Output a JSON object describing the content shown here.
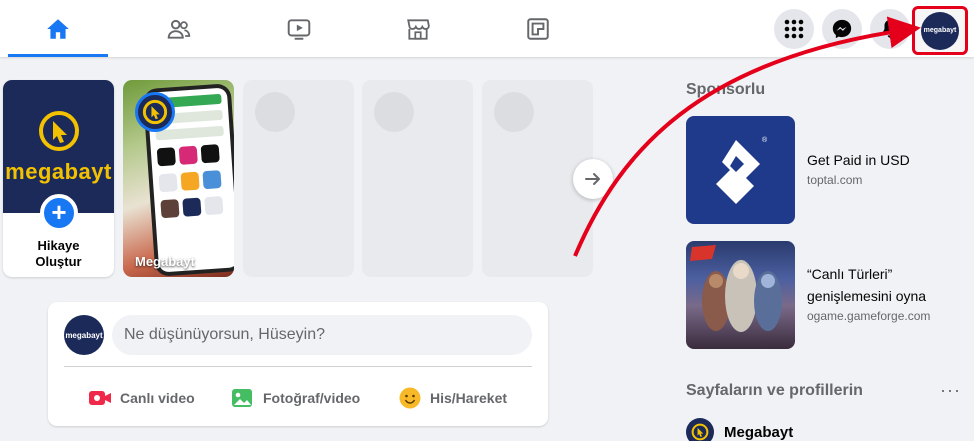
{
  "nav": {
    "tabs": [
      {
        "name": "home-icon",
        "active": true
      },
      {
        "name": "friends-icon",
        "active": false
      },
      {
        "name": "watch-icon",
        "active": false
      },
      {
        "name": "marketplace-icon",
        "active": false
      },
      {
        "name": "gaming-icon",
        "active": false
      }
    ],
    "right_buttons": [
      "menu-grid-icon",
      "messenger-icon",
      "notifications-bell-icon"
    ],
    "profile_avatar_text": "megabayt"
  },
  "stories": {
    "create_label_line1": "Hikaye",
    "create_label_line2": "Oluştur",
    "brand_word": "megabayt",
    "story_name": "Megabayt"
  },
  "composer": {
    "placeholder": "Ne düşünüyorsun, Hüseyin?",
    "avatar_text": "megabayt",
    "actions": {
      "live": "Canlı video",
      "photo": "Fotoğraf/video",
      "feeling": "His/Hareket"
    }
  },
  "right": {
    "sponsored_title": "Sponsorlu",
    "ads": [
      {
        "title": "Get Paid in USD",
        "domain": "toptal.com"
      },
      {
        "title_line1": "“Canlı Türleri”",
        "title_line2": "genişlemesini oyna",
        "domain": "ogame.gameforge.com"
      }
    ],
    "pages_title": "Sayfaların ve profillerin",
    "more": "···",
    "page_name": "Megabayt"
  },
  "colors": {
    "accent": "#1877f2",
    "annotation": "#e4001b",
    "brand_navy": "#1c2a5a",
    "brand_yellow": "#f2c200"
  }
}
